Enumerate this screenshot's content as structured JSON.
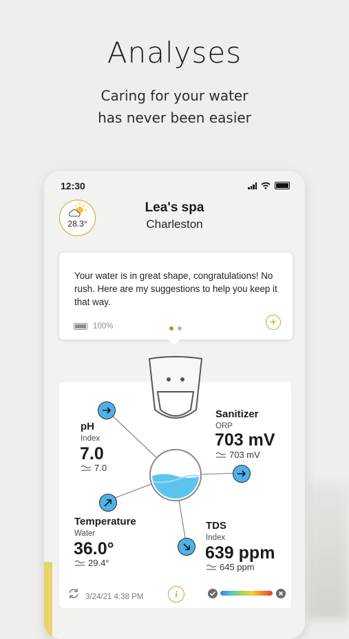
{
  "hero": {
    "title": "Analyses",
    "subtitle_line1": "Caring for your water",
    "subtitle_line2": "has never been easier"
  },
  "status_bar": {
    "time": "12:30"
  },
  "header": {
    "weather_temp": "28.3°",
    "spa_name": "Lea's spa",
    "location": "Charleston"
  },
  "message": {
    "text": "Your water is in great shape, congratulations! No rush. Here are my suggestions to help you keep it that way.",
    "battery": "100%",
    "active_dot_color": "#b8901f",
    "inactive_dot_color": "#b4b4b4"
  },
  "metrics": {
    "ph": {
      "title": "pH",
      "sub": "Index",
      "value": "7.0",
      "ideal": "7.0"
    },
    "sanitizer": {
      "title": "Sanitizer",
      "sub": "ORP",
      "value": "703 mV",
      "ideal": "703 mV"
    },
    "temperature": {
      "title": "Temperature",
      "sub": "Water",
      "value": "36.0°",
      "ideal": "29.4°"
    },
    "tds": {
      "title": "TDS",
      "sub": "Index",
      "value": "639 ppm",
      "ideal": "645 ppm"
    }
  },
  "footer": {
    "date": "3/24/21 4:38 PM",
    "info_label": "i"
  },
  "colors": {
    "accent": "#c9a227",
    "arrow": "#4eb2e8",
    "water": "#5bc4ee"
  }
}
